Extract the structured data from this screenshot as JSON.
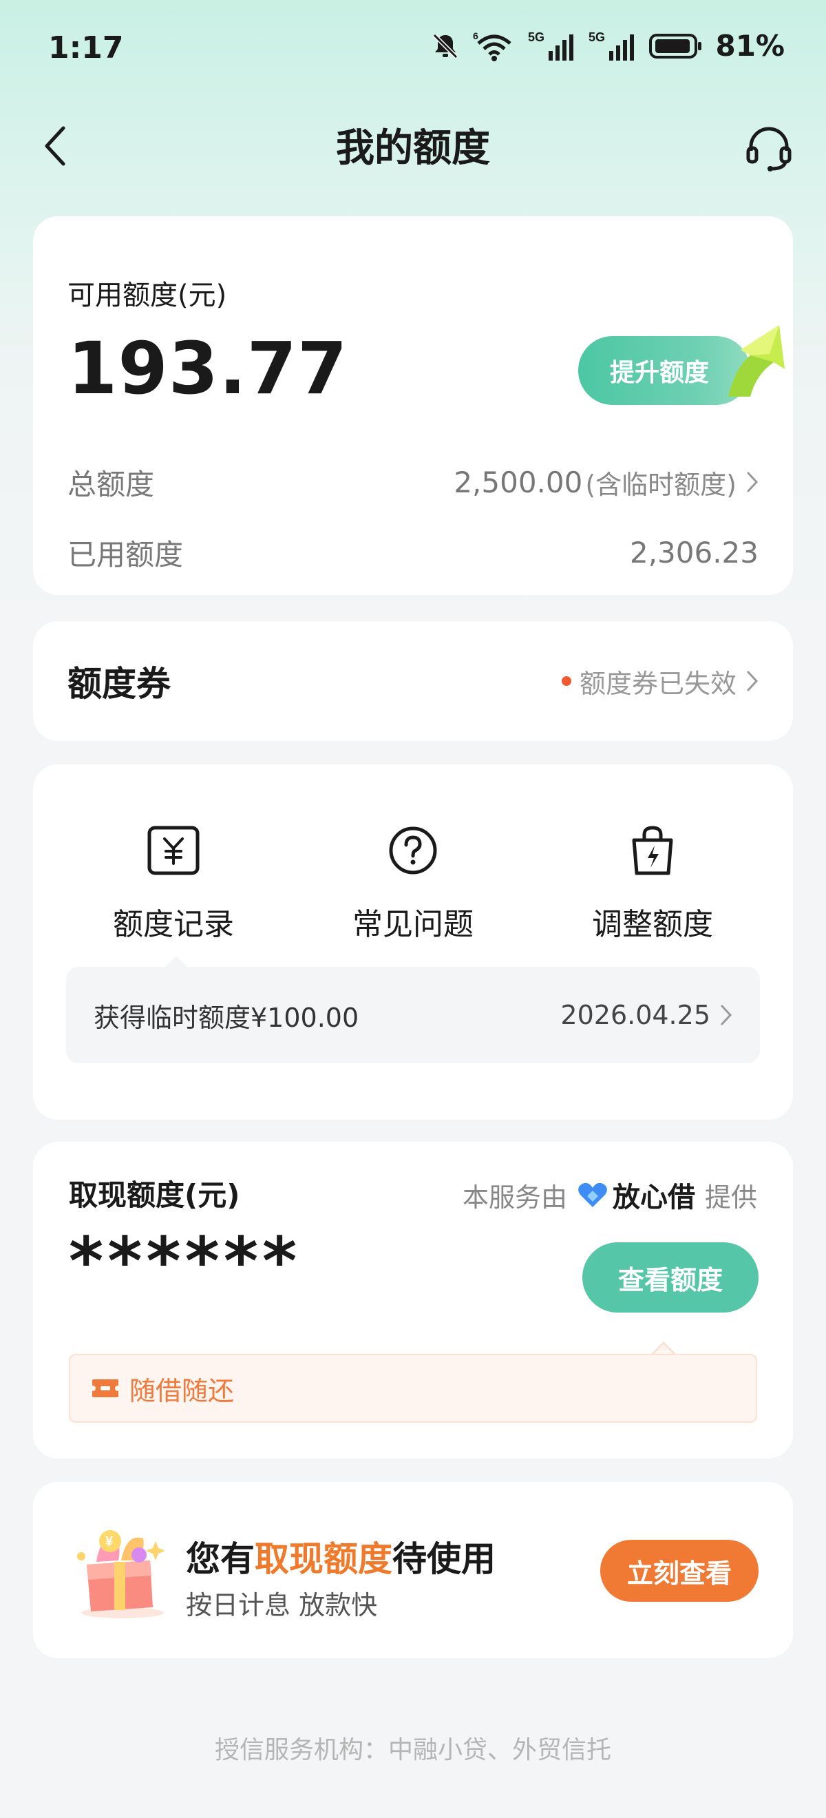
{
  "status_bar": {
    "time": "1:17",
    "battery": "81%",
    "network1": "5G",
    "network2": "5G",
    "wifi_badge": "6"
  },
  "header": {
    "title": "我的额度"
  },
  "credit": {
    "available_label": "可用额度(元)",
    "available_amount": "193.77",
    "boost_label": "提升额度",
    "total_label": "总额度",
    "total_value": "2,500.00",
    "total_note": "(含临时额度)",
    "used_label": "已用额度",
    "used_value": "2,306.23"
  },
  "voucher": {
    "title": "额度券",
    "status": "额度券已失效",
    "status_color": "#f05a30"
  },
  "menu": {
    "items": [
      {
        "label": "额度记录",
        "icon": "yuan-icon"
      },
      {
        "label": "常见问题",
        "icon": "question-icon"
      },
      {
        "label": "调整额度",
        "icon": "bag-lightning-icon"
      }
    ],
    "record_text": "获得临时额度¥100.00",
    "record_date": "2026.04.25"
  },
  "cash": {
    "title": "取现额度(元)",
    "provider_prefix": "本服务由",
    "provider_brand": "放心借",
    "provider_suffix": "提供",
    "masked_amount": "******",
    "view_label": "查看额度",
    "tag": "随借随还",
    "accent": "#55c6a8"
  },
  "promo": {
    "title_prefix": "您有",
    "title_highlight": "取现额度",
    "title_suffix": "待使用",
    "subtitle": "按日计息 放款快",
    "button": "立刻查看",
    "accent": "#f07a34"
  },
  "footer": {
    "text": "授信服务机构：中融小贷、外贸信托"
  }
}
